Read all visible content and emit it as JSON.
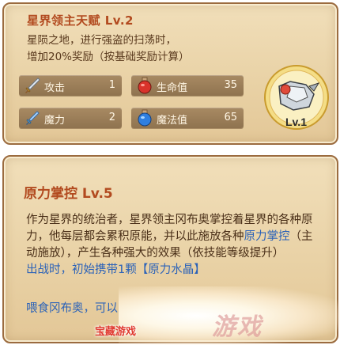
{
  "talent1": {
    "title": "星界领主天赋 Lv.2",
    "desc_line1": "星陨之地，进行强盗的扫荡时，",
    "desc_line2": "增加20%奖励（按基础奖励计算）",
    "stats": [
      {
        "label": "攻击",
        "value": "1",
        "icon": "sword-icon"
      },
      {
        "label": "生命值",
        "value": "35",
        "icon": "health-potion-icon"
      },
      {
        "label": "魔力",
        "value": "2",
        "icon": "magic-sword-icon"
      },
      {
        "label": "魔法值",
        "value": "65",
        "icon": "mana-potion-icon"
      }
    ],
    "badge_level": "Lv.1"
  },
  "talent2": {
    "title": "原力掌控 Lv.5",
    "desc_parts": {
      "p1": "作为星界的统治者，星界领主冈布奥掌控着星界的各种原力，他每层都会累积原能，并以此施放各种",
      "link": "原力掌控",
      "p2": "（主动施放），产生各种强大的效果（依技能等级提升）"
    },
    "blue_line": "出战时，初始携带1颗【原力水晶】",
    "footer_line": "喂食冈布奥，可以",
    "watermark_text": "宝藏游戏",
    "watermark_logo": "游戏"
  },
  "colors": {
    "title": "#b24a1f",
    "accent_blue": "#2b62b8",
    "panel": "#ecd6ab",
    "stat_bg": "#9a7d58"
  }
}
